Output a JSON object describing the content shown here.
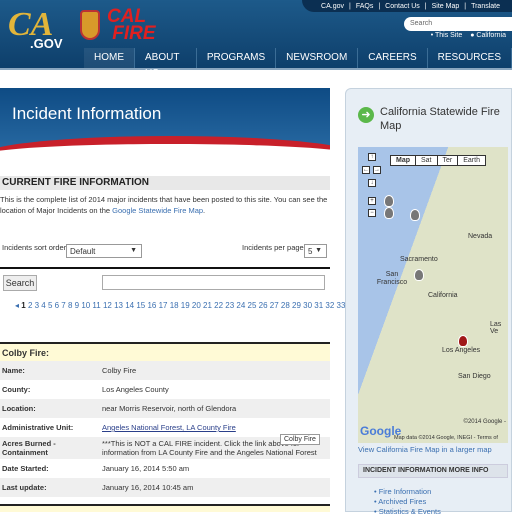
{
  "header": {
    "utility_links": [
      "CA.gov",
      "|",
      "FAQs",
      "|",
      "Contact Us",
      "|",
      "Site Map",
      "|",
      "Translate"
    ],
    "ca_logo": "CA.GOV",
    "calfire_logo": "CAL FIRE",
    "search_placeholder": "Search",
    "scope": [
      "This Site",
      "California"
    ],
    "nav": [
      "HOME",
      "ABOUT US",
      "PROGRAMS",
      "NEWSROOM",
      "CAREERS",
      "RESOURCES"
    ]
  },
  "banner": {
    "title": "Incident Information"
  },
  "main": {
    "section_title": "CURRENT FIRE INFORMATION",
    "intro": "This is the complete list of 2014 major incidents that have been posted to this site. You can see the location of Major Incidents on the ",
    "intro_link": "Google Statewide Fire Map",
    "sort_label": "Incidents sort order",
    "sort_value": "Default",
    "per_page_label": "Incidents per page",
    "per_page_value": "5",
    "search_button": "Search",
    "search_value": "",
    "pager": {
      "current": "1",
      "pages": "2 3 4 5 6 7 8 9 10 11 12 13 14 15 16 17 18 19 20 21 22 23 24 25 26 27 28 29 30 31 32 33"
    },
    "incident": {
      "title": "Colby Fire:",
      "rows": [
        {
          "k": "Name:",
          "v": "Colby Fire"
        },
        {
          "k": "County:",
          "v": "Los Angeles County"
        },
        {
          "k": "Location:",
          "v": "near Morris Reservoir, north of Glendora"
        },
        {
          "k": "Administrative Unit:",
          "v": "Angeles National Forest, LA County Fire"
        },
        {
          "k": "Acres Burned - Containment",
          "v": "***This is NOT a CAL FIRE incident. Click the link above for information from LA County Fire and the Angeles National Forest"
        },
        {
          "k": "Date Started:",
          "v": "January 16, 2014 5:50 am"
        },
        {
          "k": "Last update:",
          "v": "January 16, 2014 10:45 am"
        }
      ],
      "tooltip": "Colby Fire"
    }
  },
  "sidebar": {
    "map_title": "California Statewide Fire Map",
    "map_types": [
      "Map",
      "Sat",
      "Ter",
      "Earth"
    ],
    "map_labels": [
      "Nevada",
      "Sacramento",
      "San Francisco",
      "California",
      "Las Ve",
      "Los Angeles",
      "San Diego"
    ],
    "google": "Google",
    "copyright": "©2014 Google -",
    "map_data": "Map data ©2014 Google, INEGI - Terms of",
    "view_larger": "View California Fire Map in a larger map",
    "more_title": "INCIDENT INFORMATION MORE INFO",
    "more_links": [
      "Fire Information",
      "Archived Fires",
      "Statistics & Events"
    ]
  }
}
